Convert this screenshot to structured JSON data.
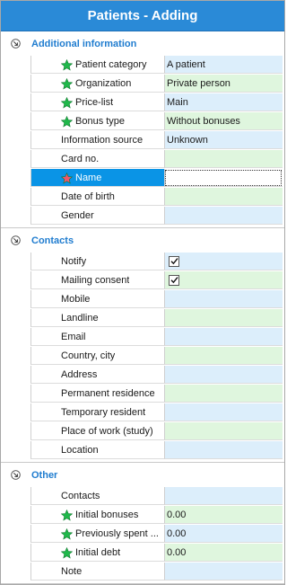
{
  "window": {
    "title": "Patients - Adding"
  },
  "colors": {
    "title_bar": "#2a8ad7",
    "section_title": "#1f7ccf",
    "row_blue": "#dceefb",
    "row_green": "#dff6de",
    "selected_row": "#0a94e6",
    "required_star": "#1fb84a",
    "selected_star": "#f0566b"
  },
  "sections": [
    {
      "title": "Additional information",
      "icon": "collapse-icon",
      "rows": [
        {
          "label": "Patient category",
          "value": "A patient",
          "required": true
        },
        {
          "label": "Organization",
          "value": "Private person",
          "required": true
        },
        {
          "label": "Price-list",
          "value": "Main",
          "required": true
        },
        {
          "label": "Bonus type",
          "value": "Without bonuses",
          "required": true
        },
        {
          "label": "Information source",
          "value": "Unknown",
          "required": false
        },
        {
          "label": "Card no.",
          "value": "",
          "required": false
        },
        {
          "label": "Name",
          "value": "",
          "required": true,
          "selected": true
        },
        {
          "label": "Date of birth",
          "value": "",
          "required": false
        },
        {
          "label": "Gender",
          "value": "",
          "required": false
        }
      ]
    },
    {
      "title": "Contacts",
      "icon": "collapse-icon",
      "rows": [
        {
          "label": "Notify",
          "checked": true,
          "required": false
        },
        {
          "label": "Mailing consent",
          "checked": true,
          "required": false
        },
        {
          "label": "Mobile",
          "value": "",
          "required": false
        },
        {
          "label": "Landline",
          "value": "",
          "required": false
        },
        {
          "label": "Email",
          "value": "",
          "required": false
        },
        {
          "label": "Country, city",
          "value": "",
          "required": false
        },
        {
          "label": "Address",
          "value": "",
          "required": false
        },
        {
          "label": "Permanent residence",
          "value": "",
          "required": false
        },
        {
          "label": "Temporary resident",
          "value": "",
          "required": false
        },
        {
          "label": "Place of work (study)",
          "value": "",
          "required": false
        },
        {
          "label": "Location",
          "value": "",
          "required": false
        }
      ]
    },
    {
      "title": "Other",
      "icon": "collapse-icon",
      "rows": [
        {
          "label": "Contacts",
          "value": "",
          "required": false
        },
        {
          "label": "Initial bonuses",
          "value": "0.00",
          "required": true
        },
        {
          "label": "Previously spent ...",
          "value": "0.00",
          "required": true
        },
        {
          "label": "Initial debt",
          "value": "0.00",
          "required": true
        },
        {
          "label": "Note",
          "value": "",
          "required": false
        }
      ]
    }
  ]
}
